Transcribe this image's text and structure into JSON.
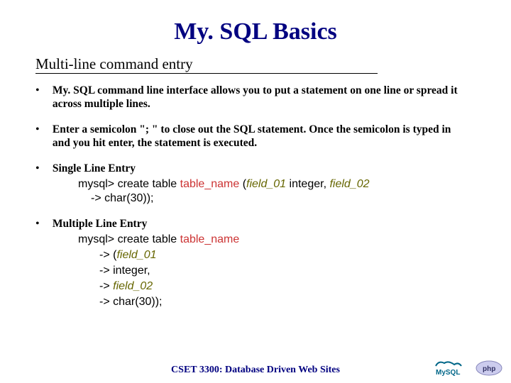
{
  "title": "My. SQL Basics",
  "subtitle": "Multi-line command entry",
  "bullets": {
    "b1": "My. SQL command line interface allows you to put a statement on one line or spread it across multiple lines.",
    "b2": "Enter a semicolon \"; \" to close out the SQL statement. Once the semicolon is typed in and you hit enter, the statement is executed.",
    "b3": "Single Line Entry",
    "b4": "Multiple Line Entry"
  },
  "code1": {
    "p1a": "mysql> create table ",
    "p1_tbl": "table_name",
    "p1b": " (",
    "p1_fld": "field_01",
    "p1c": " integer, ",
    "p1_fld2": "field_02",
    "p2a": "-> char(30));"
  },
  "code2": {
    "p1a": "mysql> create table ",
    "p1_tbl": "table_name",
    "l1a": "-> (",
    "l1_fld": "field_01",
    "l2a": "-> integer,",
    "l3a": "-> ",
    "l3_fld": "field_02",
    "l4a": "-> char(30));"
  },
  "footer": "CSET 3300: Database Driven Web Sites",
  "logos": {
    "mysql": "MySQL",
    "php": "php"
  }
}
